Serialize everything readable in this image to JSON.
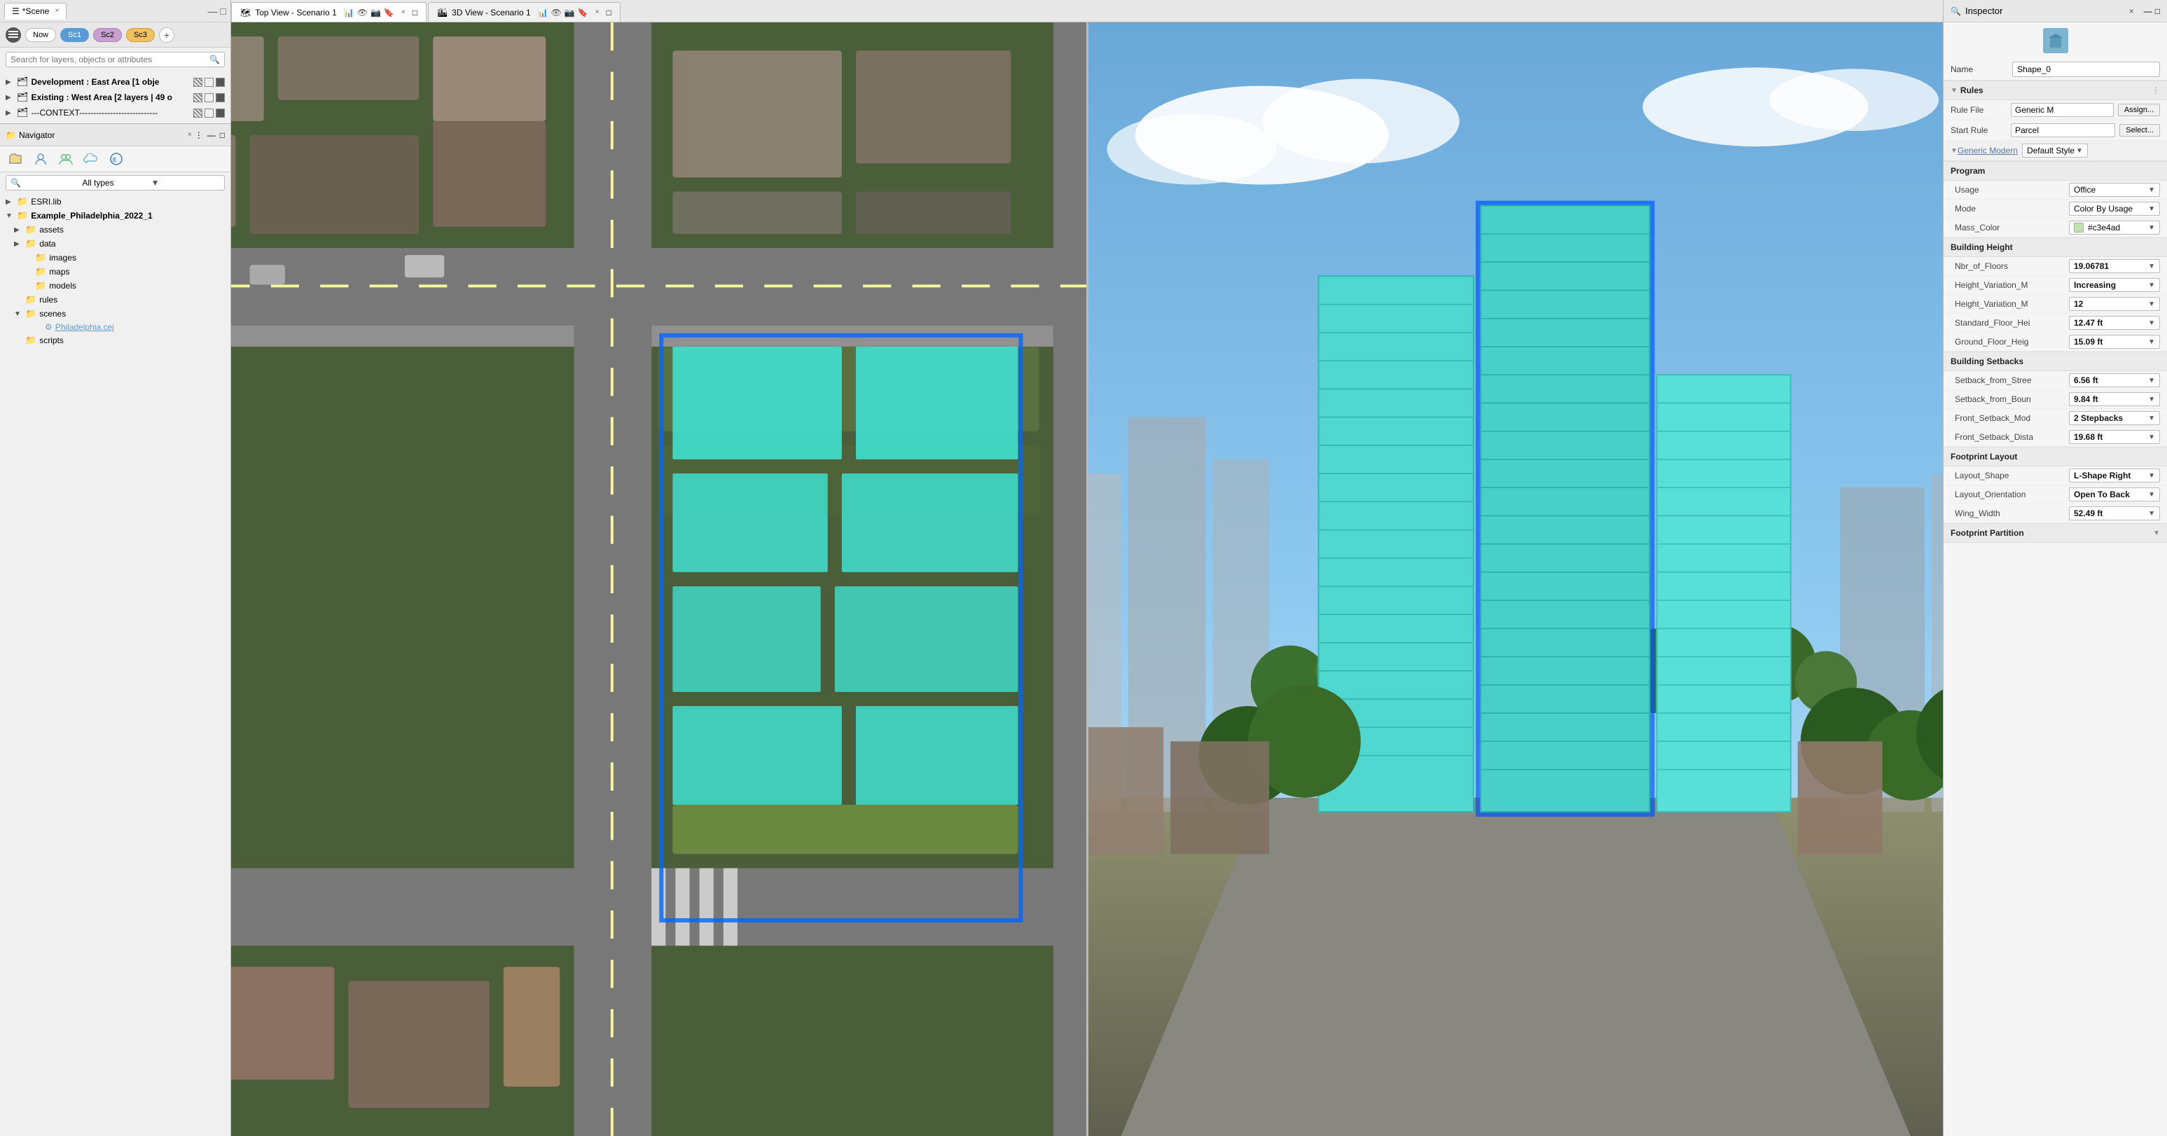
{
  "app": {
    "title": "*Scene",
    "scenarios": [
      {
        "label": "Now",
        "class": "now"
      },
      {
        "label": "Sc1",
        "class": "sc1"
      },
      {
        "label": "Sc2",
        "class": "sc2"
      },
      {
        "label": "Sc3",
        "class": "sc3"
      }
    ]
  },
  "search": {
    "placeholder": "Search for layers, objects or attributes"
  },
  "layers": [
    {
      "label": "Development : East Area [1 obje",
      "indent": 0,
      "bold": true
    },
    {
      "label": "Existing : West Area [2 layers | 49 o",
      "indent": 0,
      "bold": true
    },
    {
      "label": "---CONTEXT----------------------------",
      "indent": 0,
      "bold": false
    }
  ],
  "navigator": {
    "title": "Navigator",
    "type_filter": "All types",
    "tree": [
      {
        "label": "ESRI.lib",
        "type": "folder",
        "indent": 0,
        "expanded": false
      },
      {
        "label": "Example_Philadelphia_2022_1",
        "type": "folder",
        "indent": 0,
        "expanded": true
      },
      {
        "label": "assets",
        "type": "folder",
        "indent": 1,
        "expanded": false
      },
      {
        "label": "data",
        "type": "folder",
        "indent": 1,
        "expanded": false
      },
      {
        "label": "images",
        "type": "folder",
        "indent": 2,
        "expanded": false
      },
      {
        "label": "maps",
        "type": "folder",
        "indent": 2,
        "expanded": false
      },
      {
        "label": "models",
        "type": "folder",
        "indent": 2,
        "expanded": false
      },
      {
        "label": "rules",
        "type": "folder",
        "indent": 1,
        "expanded": false
      },
      {
        "label": "scenes",
        "type": "folder",
        "indent": 1,
        "expanded": true
      },
      {
        "label": "Philadelphia.cej",
        "type": "file",
        "indent": 3
      },
      {
        "label": "scripts",
        "type": "folder",
        "indent": 1,
        "expanded": false
      }
    ]
  },
  "views": {
    "top_view": {
      "tab_label": "Top View - Scenario 1",
      "close": "×"
    },
    "view_3d": {
      "tab_label": "3D View - Scenario 1",
      "close": "×"
    }
  },
  "inspector": {
    "title": "Inspector",
    "close": "×",
    "name_label": "Name",
    "name_value": "Shape_0",
    "rules_section": "Rules",
    "rule_file_label": "Rule File",
    "rule_file_value": "Generic M",
    "rule_file_btn1": "Assign...",
    "start_rule_label": "Start Rule",
    "start_rule_value": "Parcel",
    "start_rule_btn": "Select...",
    "style_group_label": "Generic Modern",
    "style_value": "Default Style",
    "program_section": "Program",
    "usage_label": "Usage",
    "usage_value": "Office",
    "mode_label": "Mode",
    "mode_value": "Color By Usage",
    "mass_color_label": "Mass_Color",
    "mass_color_value": "#c3e4ad",
    "building_height_section": "Building Height",
    "nbr_floors_label": "Nbr_of_Floors",
    "nbr_floors_value": "19.06781",
    "height_var1_label": "Height_Variation_M",
    "height_var1_value": "Increasing",
    "height_var2_label": "Height_Variation_M",
    "height_var2_value": "12",
    "std_floor_label": "Standard_Floor_Hei",
    "std_floor_value": "12.47 ft",
    "ground_floor_label": "Ground_Floor_Heig",
    "ground_floor_value": "15.09 ft",
    "building_setbacks_section": "Building Setbacks",
    "setback_street_label": "Setback_from_Stree",
    "setback_street_value": "6.56 ft",
    "setback_boun_label": "Setback_from_Boun",
    "setback_boun_value": "9.84 ft",
    "front_mode_label": "Front_Setback_Mod",
    "front_mode_value": "2 Stepbacks",
    "front_dist_label": "Front_Setback_Dista",
    "front_dist_value": "19.68 ft",
    "footprint_layout_section": "Footprint Layout",
    "layout_shape_label": "Layout_Shape",
    "layout_shape_value": "L-Shape Right",
    "layout_orient_label": "Layout_Orientation",
    "layout_orient_value": "Open To Back",
    "wing_width_label": "Wing_Width",
    "wing_width_value": "52.49 ft",
    "footprint_partition_section": "Footprint Partition"
  }
}
